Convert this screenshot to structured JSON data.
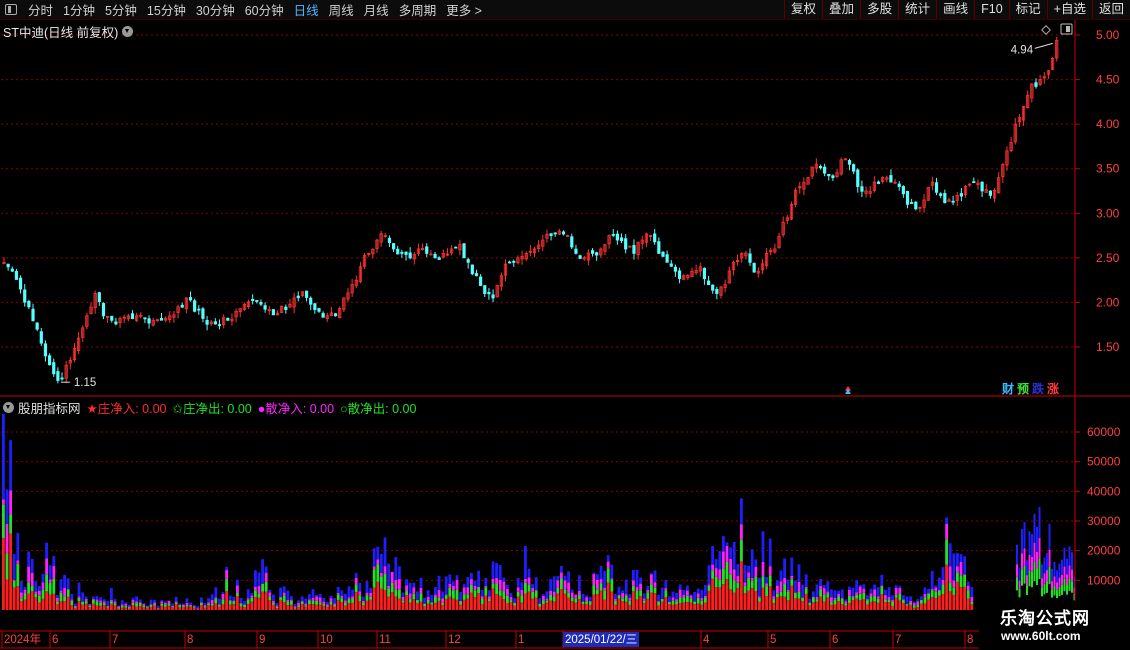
{
  "toolbar": {
    "periods": [
      "分时",
      "1分钟",
      "5分钟",
      "15分钟",
      "30分钟",
      "60分钟",
      "日线",
      "周线",
      "月线",
      "多周期",
      "更多 >"
    ],
    "active_period": "日线",
    "buttons": [
      "复权",
      "叠加",
      "多股",
      "统计",
      "画线",
      "F10",
      "标记",
      "+自选",
      "返回"
    ]
  },
  "main_chart": {
    "title": "ST中迪(日线 前复权)",
    "y_ticks": [
      "5.00",
      "4.50",
      "4.00",
      "3.50",
      "3.00",
      "2.50",
      "2.00",
      "1.50"
    ],
    "low_label": "1.15",
    "high_label": "4.94",
    "badges": [
      {
        "label": "财",
        "color": "#3fb8ff"
      },
      {
        "label": "预",
        "color": "#3ce43c"
      },
      {
        "label": "跌",
        "color": "#2e2ed8"
      },
      {
        "label": "涨",
        "color": "#ff3a3a"
      }
    ]
  },
  "indicator": {
    "name": "股朋指标网",
    "legend": [
      {
        "label": "★庄净入: 0.00",
        "color": "#ff2a2a"
      },
      {
        "label": "✩庄净出: 0.00",
        "color": "#22e022"
      },
      {
        "label": "●散净入: 0.00",
        "color": "#ff22ff"
      },
      {
        "label": "○散净出: 0.00",
        "color": "#22e022"
      }
    ],
    "y_ticks": [
      "60000",
      "50000",
      "40000",
      "30000",
      "20000",
      "10000"
    ]
  },
  "time_axis": {
    "labels": [
      "2024年",
      "6",
      "7",
      "8",
      "9",
      "10",
      "11",
      "12",
      "1",
      "2025/01/22/三",
      "4",
      "5",
      "6",
      "7",
      "8"
    ]
  },
  "watermark": {
    "line1": "乐淘公式网",
    "line2": "www.60lt.com"
  },
  "colors": {
    "up": "#ff3232",
    "down": "#54ffff",
    "grid": "#8a0000",
    "axis": "#c80000",
    "tick": "#ff4040"
  },
  "chart_data": [
    {
      "type": "candlestick",
      "title": "ST中迪(日线 前复权)",
      "ylim": [
        1.0,
        5.1
      ],
      "y_ticks": [
        1.5,
        2.0,
        2.5,
        3.0,
        3.5,
        4.0,
        4.5,
        5.0
      ],
      "x_range": [
        "2024-05",
        "2025-08"
      ],
      "close_path": [
        2.45,
        2.35,
        2.15,
        1.95,
        1.7,
        1.4,
        1.2,
        1.15,
        1.35,
        1.6,
        1.85,
        2.1,
        1.85,
        1.8,
        1.82,
        1.85,
        1.85,
        1.82,
        1.8,
        1.8,
        1.85,
        1.95,
        2.05,
        1.9,
        1.82,
        1.78,
        1.75,
        1.8,
        1.9,
        1.98,
        2.02,
        1.98,
        1.92,
        1.88,
        1.92,
        2.05,
        2.12,
        1.98,
        1.9,
        1.85,
        1.85,
        2.05,
        2.2,
        2.4,
        2.55,
        2.7,
        2.75,
        2.6,
        2.55,
        2.5,
        2.6,
        2.55,
        2.5,
        2.55,
        2.6,
        2.65,
        2.45,
        2.3,
        2.1,
        2.05,
        2.3,
        2.45,
        2.5,
        2.55,
        2.6,
        2.7,
        2.75,
        2.8,
        2.75,
        2.55,
        2.5,
        2.55,
        2.6,
        2.75,
        2.7,
        2.6,
        2.55,
        2.7,
        2.75,
        2.55,
        2.45,
        2.35,
        2.3,
        2.35,
        2.4,
        2.2,
        2.1,
        2.2,
        2.45,
        2.55,
        2.45,
        2.35,
        2.55,
        2.6,
        2.9,
        3.1,
        3.3,
        3.4,
        3.55,
        3.45,
        3.4,
        3.6,
        3.55,
        3.3,
        3.25,
        3.35,
        3.4,
        3.35,
        3.3,
        3.1,
        3.05,
        3.15,
        3.35,
        3.2,
        3.15,
        3.2,
        3.3,
        3.35,
        3.25,
        3.2,
        3.4,
        3.7,
        4.0,
        4.2,
        4.45,
        4.5,
        4.6,
        4.94
      ],
      "low": 1.15,
      "high": 4.94
    },
    {
      "type": "bar",
      "stacked": true,
      "title": "股朋指标网",
      "series": [
        {
          "name": "庄净入",
          "color": "#ff2a2a",
          "value": 0.0
        },
        {
          "name": "庄净出",
          "color": "#22e022",
          "value": 0.0
        },
        {
          "name": "散净入",
          "color": "#ff22ff",
          "value": 0.0
        },
        {
          "name": "散净出",
          "color": "#22e022",
          "value": 0.0
        }
      ],
      "ylim": [
        0,
        66000
      ],
      "y_ticks": [
        10000,
        20000,
        30000,
        40000,
        50000,
        60000
      ],
      "volume_envelope": [
        65000,
        58000,
        30000,
        12000,
        20000,
        8000,
        15000,
        35000,
        6000,
        18000,
        12000,
        5000,
        14000,
        4000,
        6000,
        3000,
        9000,
        3000,
        4000,
        2500,
        5000,
        3000,
        4000,
        3500,
        3000,
        4000,
        5000,
        6000,
        4500,
        3500,
        4000,
        5000,
        7000,
        12000,
        14000,
        10000,
        8000,
        9000,
        15000,
        20000,
        12000,
        6000,
        8000,
        6000,
        5000,
        7000,
        6000,
        8000,
        5000,
        7000,
        9000,
        6000,
        10000,
        12000,
        9000,
        14000,
        20000,
        30000,
        34000,
        25000,
        16000,
        12000,
        9000,
        10000,
        8000,
        9000,
        12000,
        10000,
        14000,
        9000,
        11000,
        13000,
        15000,
        12000,
        18000,
        16000,
        12000,
        10000,
        18000,
        22000,
        12000,
        9000,
        8000,
        11000,
        15000,
        14000,
        10000,
        13000,
        9000,
        12000,
        20000,
        24000,
        16000,
        14000,
        12000,
        14000,
        12000,
        11000,
        12000,
        14000,
        10000,
        8000,
        10000,
        13000,
        12000,
        10000,
        26000,
        30000,
        28000,
        24000,
        22000,
        38000,
        44000,
        38000,
        28000,
        30000,
        18000,
        22000,
        20000,
        16000,
        14000,
        12000,
        10000,
        9000,
        12000,
        8000,
        10000,
        9000,
        12000,
        10000,
        8000,
        9000,
        12000,
        10000,
        8000,
        9000,
        6000,
        7000,
        8000,
        9000,
        12000,
        30000,
        34000,
        28000,
        22000,
        20000,
        16000
      ]
    }
  ]
}
